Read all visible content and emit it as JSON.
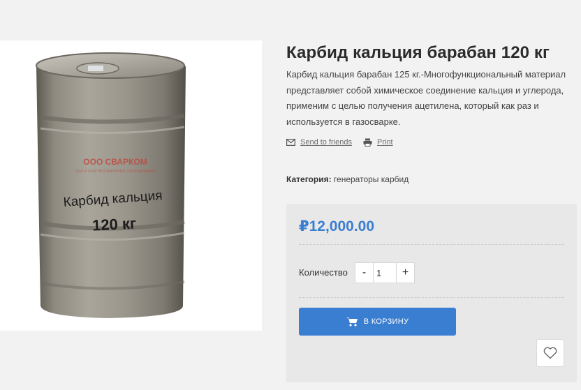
{
  "product": {
    "image_alt": "Карбид кальция барабан 120 кг",
    "drum_text_line1": "Карбид кальция",
    "drum_text_line2": "120 кг",
    "drum_brand": "ООО СВАРКОМ",
    "drum_brand_sub": "ГАЗО И ЭЛЕКТРОСВАРОЧНОЕ ОБОРУДОВАНИЕ",
    "title": "Карбид кальция барабан 120 кг",
    "description": "Карбид кальция барабан 125 кг.-Многофункциональный материал представляет собой химическое соединение кальция и углерода, применим с целью получения ацетилена, который как раз и используется в газосварке.",
    "share": {
      "send_label": "Send to friends",
      "send_icon": "envelope-icon",
      "print_label": "Print",
      "print_icon": "printer-icon"
    },
    "category_label": "Категория:",
    "category_value": "генераторы карбид"
  },
  "buy_box": {
    "price": "₽12,000.00",
    "qty_label": "Количество",
    "qty_minus": "-",
    "qty_value": "1",
    "qty_plus": "+",
    "cart_label": "В КОРЗИНУ",
    "cart_icon": "cart-icon",
    "wishlist_icon": "heart-icon"
  },
  "colors": {
    "accent": "#3a7ed1",
    "background": "#f2f2f2",
    "buy_box_bg": "#e8e8e8"
  }
}
